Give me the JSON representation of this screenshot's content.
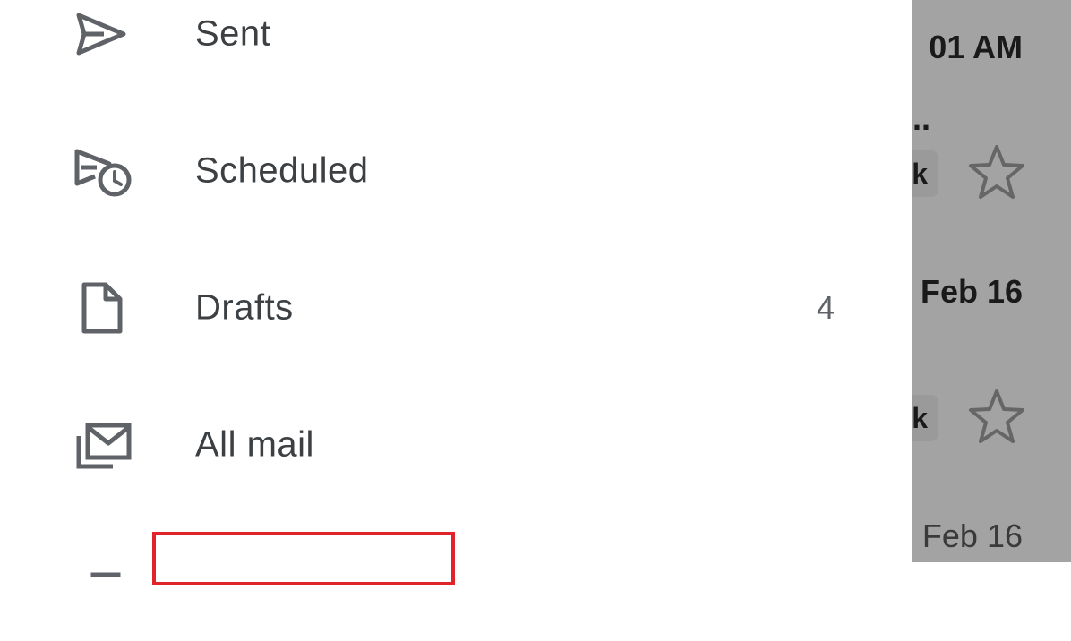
{
  "drawer": {
    "items": [
      {
        "label": "Sent",
        "icon": "send-icon"
      },
      {
        "label": "Scheduled",
        "icon": "scheduled-send-icon"
      },
      {
        "label": "Drafts",
        "icon": "draft-icon",
        "count": "4"
      },
      {
        "label": "All mail",
        "icon": "all-mail-icon"
      }
    ]
  },
  "background_list": {
    "rows": [
      {
        "time": "01 AM",
        "snippet_end": "..",
        "chip": "k"
      },
      {
        "time": "Feb 16",
        "chip": "k"
      },
      {
        "time": "Feb 16"
      }
    ]
  },
  "colors": {
    "highlight": "#e0242a",
    "scrim": "#a3a3a3",
    "text": "#3c4043"
  }
}
